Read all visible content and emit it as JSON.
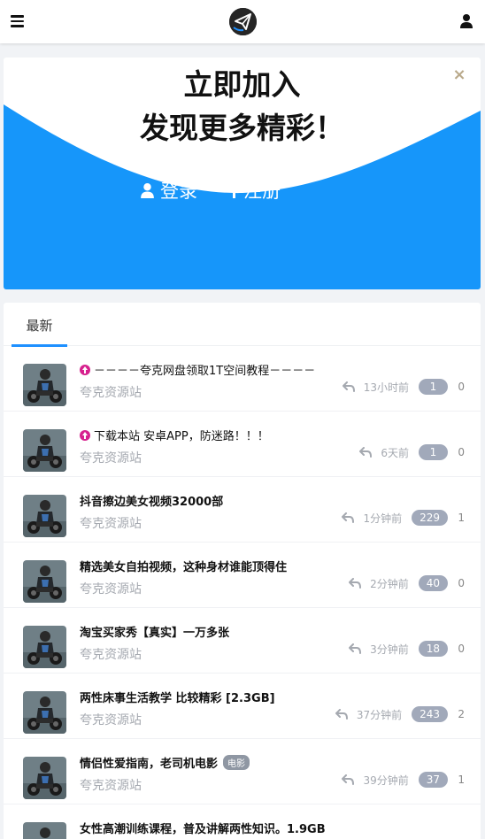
{
  "colors": {
    "accent": "#1e90ff",
    "wave": "#1696fa",
    "badge_bg": "#a1a9ba",
    "up_icon": "#d6218e"
  },
  "header": {
    "menu_icon": "hamburger-menu-icon",
    "logo_icon": "paper-plane-logo",
    "user_icon": "user-icon"
  },
  "banner": {
    "title_line1": "立即加入",
    "title_line2": "发现更多精彩！",
    "close_label": "×",
    "login_label": "登录",
    "register_label": "注册"
  },
  "tabs": [
    {
      "label": "最新"
    }
  ],
  "posts": [
    {
      "title": "－－－－夸克网盘领取1T空间教程－－－－",
      "author": "夸克资源站",
      "time": "13小时前",
      "views": "1",
      "replies": "0",
      "pinned": true,
      "tag": ""
    },
    {
      "title": "下载本站 安卓APP，防迷路！！！",
      "author": "夸克资源站",
      "time": "6天前",
      "views": "1",
      "replies": "0",
      "pinned": true,
      "tag": ""
    },
    {
      "title": "抖音擦边美女视频32000部",
      "author": "夸克资源站",
      "time": "1分钟前",
      "views": "229",
      "replies": "1",
      "pinned": false,
      "tag": ""
    },
    {
      "title": "精选美女自拍视频，这种身材谁能顶得住",
      "author": "夸克资源站",
      "time": "2分钟前",
      "views": "40",
      "replies": "0",
      "pinned": false,
      "tag": ""
    },
    {
      "title": "淘宝买家秀【真实】一万多张",
      "author": "夸克资源站",
      "time": "3分钟前",
      "views": "18",
      "replies": "0",
      "pinned": false,
      "tag": ""
    },
    {
      "title": "两性床事生活教学 比较精彩 [2.3GB]",
      "author": "夸克资源站",
      "time": "37分钟前",
      "views": "243",
      "replies": "2",
      "pinned": false,
      "tag": ""
    },
    {
      "title": "情侣性爱指南，老司机电影",
      "author": "夸克资源站",
      "time": "39分钟前",
      "views": "37",
      "replies": "1",
      "pinned": false,
      "tag": "电影"
    },
    {
      "title": "女性高潮训练课程，普及讲解两性知识。1.9GB",
      "author": "",
      "time": "",
      "views": "",
      "replies": "",
      "pinned": false,
      "tag": ""
    }
  ]
}
